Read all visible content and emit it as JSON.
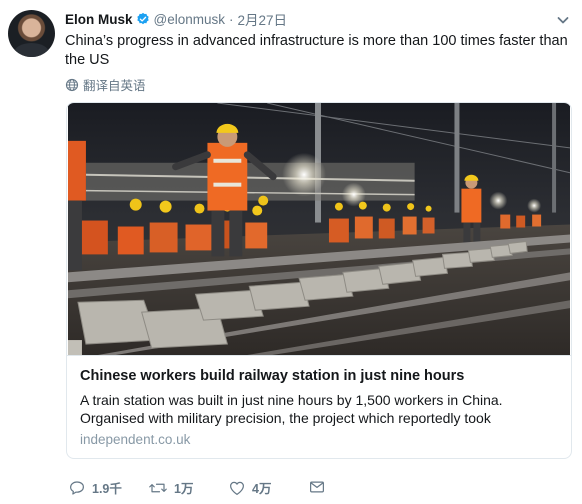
{
  "tweet": {
    "author_name": "Elon Musk",
    "handle": "@elonmusk",
    "separator": "·",
    "date": "2月27日",
    "text": "China’s progress in advanced infrastructure is more than 100 times faster than the US",
    "translate_label": "翻译自英语",
    "verified": true
  },
  "card": {
    "title": "Chinese workers build railway station in just nine hours",
    "description": "A train station was built in just nine hours by 1,500 workers in China. Organised with military precision, the project which reportedly took",
    "domain": "independent.co.uk"
  },
  "actions": {
    "reply_count": "1.9千",
    "retweet_count": "1万",
    "like_count": "4万"
  },
  "icons": {
    "verified": "verified-badge-icon",
    "caret": "chevron-down-icon",
    "translate": "globe-icon",
    "reply": "reply-icon",
    "retweet": "retweet-icon",
    "like": "heart-icon",
    "dm": "envelope-icon"
  },
  "colors": {
    "verified_blue": "#1da1f2",
    "muted": "#657786",
    "text": "#14171a",
    "border": "#e1e8ed"
  }
}
